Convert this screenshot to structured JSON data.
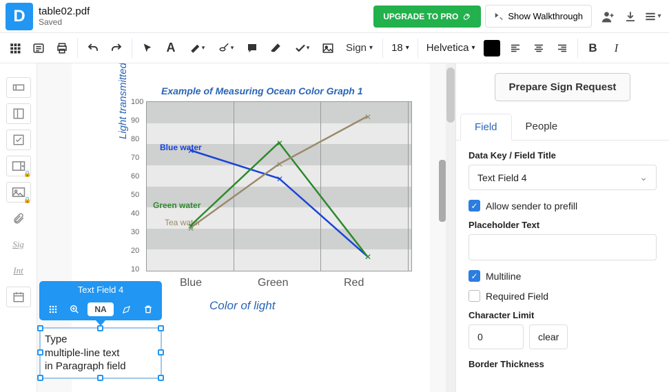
{
  "header": {
    "filename": "table02.pdf",
    "saved_label": "Saved",
    "upgrade_label": "UPGRADE TO PRO",
    "walkthrough_label": "Show Walkthrough"
  },
  "toolbar": {
    "sign_label": "Sign",
    "font_size": "18",
    "font_family": "Helvetica",
    "color": "#000000"
  },
  "chart_data": {
    "type": "line",
    "title": "Example of Measuring Ocean Color Graph 1",
    "xlabel": "Color of light",
    "ylabel": "Light transmitted (%)",
    "categories": [
      "Blue",
      "Green",
      "Red"
    ],
    "ylim": [
      10,
      100
    ],
    "yticks": [
      10,
      20,
      30,
      40,
      50,
      60,
      70,
      80,
      90,
      100
    ],
    "series": [
      {
        "name": "Blue water",
        "color": "#1944d6",
        "values": [
          74,
          59,
          18
        ]
      },
      {
        "name": "Green water",
        "color": "#2c8a2c",
        "values": [
          34,
          78,
          18
        ]
      },
      {
        "name": "Tea water",
        "color": "#9a8a6a",
        "values": [
          33,
          67,
          92
        ]
      }
    ]
  },
  "xticks": {
    "blue": "Blue",
    "green": "Green",
    "red": "Red"
  },
  "seriesLabels": {
    "blue": "Blue water",
    "green": "Green water",
    "tea": "Tea water"
  },
  "field_overlay": {
    "title": "Text Field 4",
    "badge": "NA",
    "sample_line1": "Type",
    "sample_line2": "multiple-line text",
    "sample_line3": "in Paragraph field"
  },
  "right_panel": {
    "prepare_label": "Prepare Sign Request",
    "tab_field": "Field",
    "tab_people": "People",
    "data_key_label": "Data Key / Field Title",
    "data_key_value": "Text Field 4",
    "allow_prefill_label": "Allow sender to prefill",
    "placeholder_label": "Placeholder Text",
    "placeholder_value": "",
    "multiline_label": "Multiline",
    "required_label": "Required Field",
    "char_limit_label": "Character Limit",
    "char_limit_value": "0",
    "char_limit_clear": "clear",
    "border_label": "Border Thickness"
  }
}
